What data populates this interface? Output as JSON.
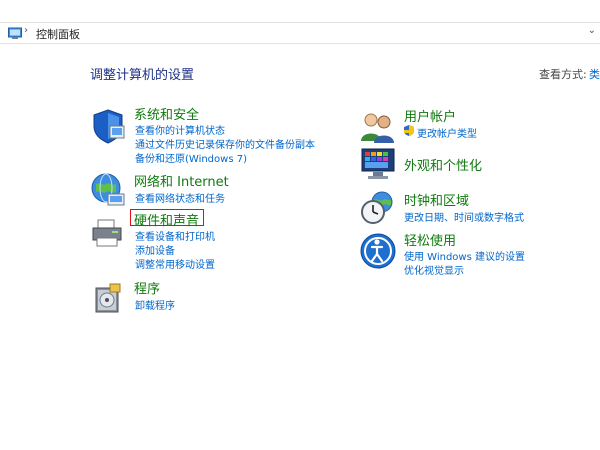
{
  "address": {
    "path": "控制面板"
  },
  "page_title": "调整计算机的设置",
  "view_by": {
    "label": "查看方式:",
    "value": "类"
  },
  "left": [
    {
      "title": "系统和安全",
      "icon": "shield-icon",
      "links": [
        "查看你的计算机状态",
        "通过文件历史记录保存你的文件备份副本",
        "备份和还原(Windows 7)"
      ]
    },
    {
      "title": "网络和 Internet",
      "icon": "network-globe-icon",
      "links": [
        "查看网络状态和任务"
      ]
    },
    {
      "title": "硬件和声音",
      "icon": "printer-icon",
      "links": [
        "查看设备和打印机",
        "添加设备",
        "调整常用移动设置"
      ],
      "highlighted": true
    },
    {
      "title": "程序",
      "icon": "programs-disk-icon",
      "links": [
        "卸载程序"
      ]
    }
  ],
  "right": [
    {
      "title": "用户帐户",
      "icon": "users-icon",
      "links": [
        "更改帐户类型"
      ],
      "link_icon": "uac-shield-icon"
    },
    {
      "title": "外观和个性化",
      "icon": "display-palette-icon",
      "links": []
    },
    {
      "title": "时钟和区域",
      "icon": "clock-globe-icon",
      "links": [
        "更改日期、时间或数字格式"
      ]
    },
    {
      "title": "轻松使用",
      "icon": "ease-of-access-icon",
      "links": [
        "使用 Windows 建议的设置",
        "优化视觉显示"
      ]
    }
  ]
}
